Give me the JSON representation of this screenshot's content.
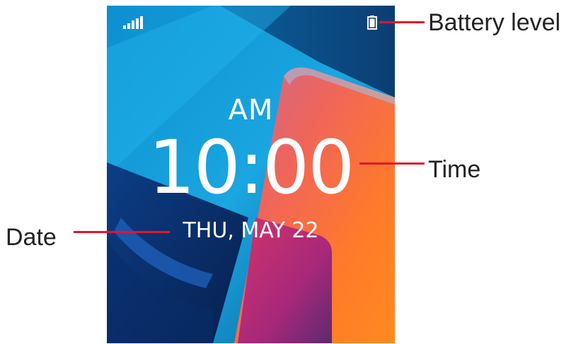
{
  "lockscreen": {
    "ampm": "AM",
    "time": "10:00",
    "date": "THU, MAY 22",
    "status_bar": {
      "signal_icon": "signal-strength-icon",
      "battery_icon": "battery-icon"
    }
  },
  "callouts": {
    "battery": "Battery level",
    "time": "Time",
    "date": "Date"
  },
  "colors": {
    "callout_line": "#e4142b",
    "text": "#ffffff",
    "label_text": "#222222"
  }
}
